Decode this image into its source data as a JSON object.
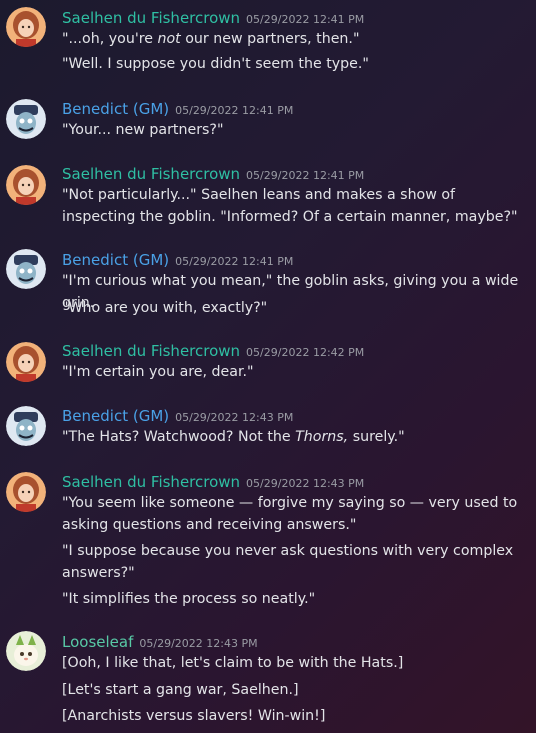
{
  "users": {
    "saelhen": {
      "name": "Saelhen du Fishercrown",
      "color": "#2fbfa3",
      "avatar_icon": "woman-portrait-avatar"
    },
    "benedict": {
      "name": "Benedict (GM)",
      "color": "#4aa1e6",
      "avatar_icon": "goblin-portrait-avatar"
    },
    "looseleaf": {
      "name": "Looseleaf",
      "color": "#58c9a6",
      "avatar_icon": "creature-portrait-avatar"
    }
  },
  "messages": [
    {
      "author": "Saelhen du Fishercrown",
      "timestamp": "05/29/2022 12:41 PM",
      "lines": [
        "\"...oh, you're not our new partners, then.\"",
        "\"Well. I suppose you didn't seem the type.\""
      ]
    },
    {
      "author": "Benedict (GM)",
      "timestamp": "05/29/2022 12:41 PM",
      "lines": [
        "\"Your... new partners?\""
      ]
    },
    {
      "author": "Saelhen du Fishercrown",
      "timestamp": "05/29/2022 12:41 PM",
      "lines": [
        "\"Not particularly...\" Saelhen leans and makes a show of inspecting the goblin. \"Informed? Of a certain manner, maybe?\""
      ]
    },
    {
      "author": "Benedict (GM)",
      "timestamp": "05/29/2022 12:41 PM",
      "lines": [
        "\"I'm curious what you mean,\" the goblin asks, giving you a wide grin.",
        "\"Who are you with, exactly?\""
      ]
    },
    {
      "author": "Saelhen du Fishercrown",
      "timestamp": "05/29/2022 12:42 PM",
      "lines": [
        "\"I'm certain you are, dear.\""
      ]
    },
    {
      "author": "Benedict (GM)",
      "timestamp": "05/29/2022 12:43 PM",
      "lines": [
        "\"The Hats? Watchwood? Not the Thorns, surely.\""
      ]
    },
    {
      "author": "Saelhen du Fishercrown",
      "timestamp": "05/29/2022 12:43 PM",
      "lines": [
        "\"You seem like someone — forgive my saying so — very used to asking questions and receiving answers.\"",
        "\"I suppose because you never ask questions with very complex answers?\"",
        "\"It simplifies the process so neatly.\""
      ]
    },
    {
      "author": "Looseleaf",
      "timestamp": "05/29/2022 12:43 PM",
      "lines": [
        "[Ooh, I like that, let's claim to be with the Hats.]",
        "[Let's start a gang war, Saelhen.]",
        "[Anarchists versus slavers! Win-win!]"
      ]
    }
  ]
}
